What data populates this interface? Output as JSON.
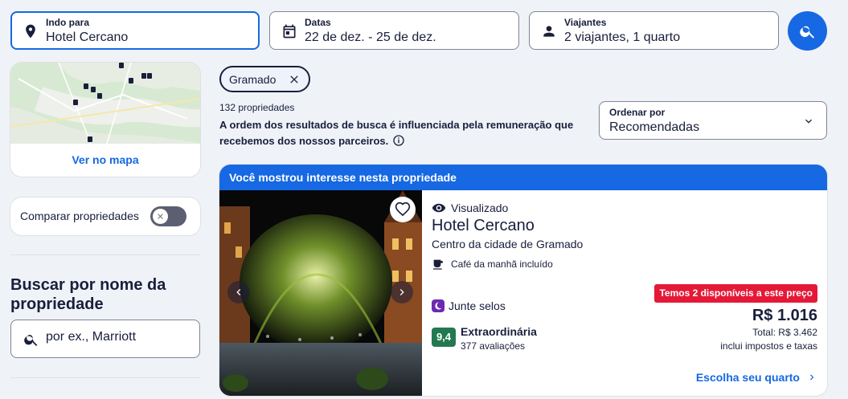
{
  "search": {
    "destination_label": "Indo para",
    "destination_value": "Hotel Cercano",
    "dates_label": "Datas",
    "dates_value": "22 de dez. - 25 de dez.",
    "travelers_label": "Viajantes",
    "travelers_value": "2 viajantes, 1 quarto",
    "search_icon": "search-icon"
  },
  "sidebar": {
    "map_link": "Ver no mapa",
    "compare_label": "Comparar propriedades",
    "name_search_heading": "Buscar por nome da propriedade",
    "name_search_placeholder": "por ex., Marriott"
  },
  "filters": {
    "chip_label": "Gramado"
  },
  "results": {
    "count": "132 propriedades",
    "notice": "A ordem dos resultados de busca é influenciada pela remuneração que recebemos dos nossos parceiros.",
    "sort_label": "Ordenar por",
    "sort_value": "Recomendadas"
  },
  "listing": {
    "banner": "Você mostrou interesse nesta propriedade",
    "viewed": "Visualizado",
    "name": "Hotel Cercano",
    "location": "Centro da cidade de Gramado",
    "amenity": "Café da manhã incluído",
    "stamps": "Junte selos",
    "score": "9,4",
    "rating_word": "Extraordinária",
    "reviews": "377 avaliações",
    "availability": "Temos 2 disponíveis a este preço",
    "price": "R$ 1.016",
    "total": "Total: R$ 3.462",
    "taxes": "inclui impostos e taxas",
    "cta": "Escolha seu quarto"
  },
  "colors": {
    "accent": "#1668e3",
    "alert": "#e51937",
    "score": "#227950",
    "text": "#191e3b"
  }
}
